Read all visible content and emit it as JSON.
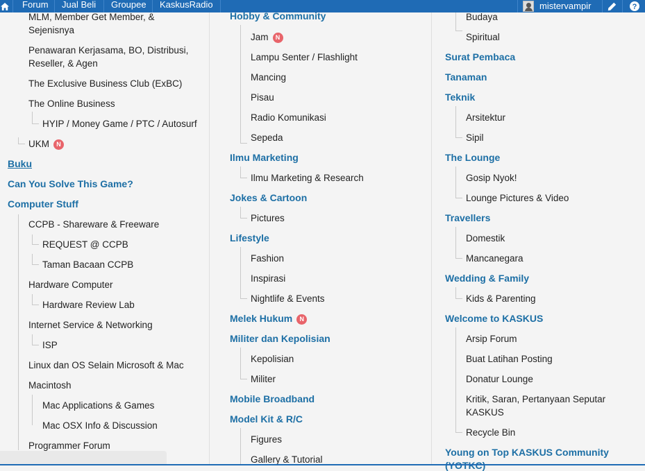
{
  "topbar": {
    "nav": [
      "Forum",
      "Jual Beli",
      "Groupee",
      "KaskusRadio"
    ],
    "username": "mistervampir",
    "icons": [
      "home-icon",
      "pencil-icon",
      "help-icon"
    ]
  },
  "col1": {
    "items": [
      "MLM, Member Get Member, &",
      "Sejenisnya",
      "Penawaran Kerjasama, BO, Distribusi,",
      "Reseller, & Agen",
      "The Exclusive Business Club (ExBC)",
      "The Online Business",
      "HYIP / Money Game / PTC / Autosurf",
      "UKM",
      "Buku",
      "Can You Solve This Game?",
      "Computer Stuff",
      "CCPB - Shareware & Freeware",
      "REQUEST @ CCPB",
      "Taman Bacaan CCPB",
      "Hardware Computer",
      "Hardware Review Lab",
      "Internet Service & Networking",
      "ISP",
      "Linux dan OS Selain Microsoft & Mac",
      "Macintosh",
      "Mac Applications & Games",
      "Mac OSX Info & Discussion",
      "Programmer Forum"
    ]
  },
  "col2": {
    "items": [
      "Hobby & Community",
      "Jam",
      "Lampu Senter / Flashlight",
      "Mancing",
      "Pisau",
      "Radio Komunikasi",
      "Sepeda",
      "Ilmu Marketing",
      "Ilmu Marketing & Research",
      "Jokes & Cartoon",
      "Pictures",
      "Lifestyle",
      "Fashion",
      "Inspirasi",
      "Nightlife & Events",
      "Melek Hukum",
      "Militer dan Kepolisian",
      "Kepolisian",
      "Militer",
      "Mobile Broadband",
      "Model Kit & R/C",
      "Figures",
      "Gallery & Tutorial"
    ]
  },
  "col3": {
    "items": [
      "Budaya",
      "Spiritual",
      "Surat Pembaca",
      "Tanaman",
      "Teknik",
      "Arsitektur",
      "Sipil",
      "The Lounge",
      "Gosip Nyok!",
      "Lounge Pictures & Video",
      "Travellers",
      "Domestik",
      "Mancanegara",
      "Wedding & Family",
      "Kids & Parenting",
      "Welcome to KASKUS",
      "Arsip Forum",
      "Buat Latihan Posting",
      "Donatur Lounge",
      "Kritik, Saran, Pertanyaan Seputar",
      "KASKUS",
      "Recycle Bin",
      "Young on Top KASKUS Community",
      "(YOTKC)"
    ]
  },
  "badge": "N",
  "colors": {
    "topbar": "#1f6bb5",
    "link": "#1d6fa5",
    "badge": "#e8646a"
  }
}
